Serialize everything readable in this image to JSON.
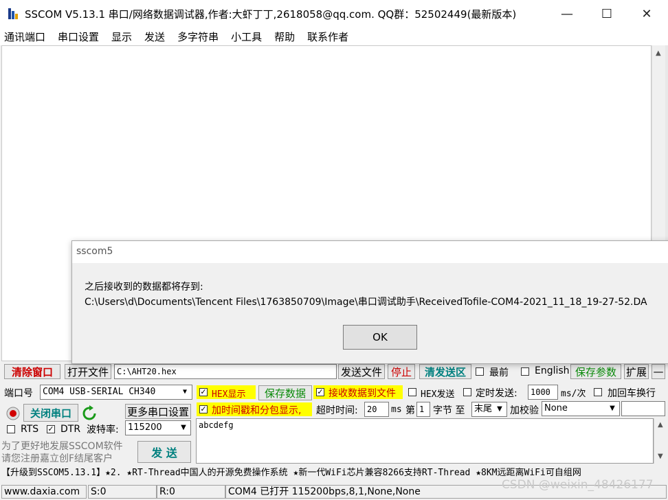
{
  "window": {
    "title": "SSCOM V5.13.1 串口/网络数据调试器,作者:大虾丁丁,2618058@qq.com. QQ群：52502449(最新版本)",
    "minimize": "—",
    "maximize": "☐",
    "close": "✕"
  },
  "menu": [
    "通讯端口",
    "串口设置",
    "显示",
    "发送",
    "多字符串",
    "小工具",
    "帮助",
    "联系作者"
  ],
  "dialog": {
    "title": "sscom5",
    "message_line1": "之后接收到的数据都将存到:",
    "message_line2": "C:\\Users\\d\\Documents\\Tencent Files\\1763850709\\Image\\串口调试助手\\ReceivedTofile-COM4-2021_11_18_19-27-52.DA",
    "ok": "OK"
  },
  "toolbar1": {
    "clear_window": "清除窗口",
    "open_file": "打开文件",
    "file_path": "C:\\AHT20.hex",
    "send_file": "发送文件",
    "stop": "停止",
    "clear_send": "清发送区",
    "topmost": "最前",
    "english": "English",
    "save_params": "保存参数",
    "expand": "扩展",
    "collapse": "—"
  },
  "port_panel": {
    "port_label": "端口号",
    "port_value": "COM4 USB-SERIAL CH340",
    "close_port": "关闭串口",
    "more_settings": "更多串口设置",
    "rts": "RTS",
    "dtr": "DTR",
    "baud_label": "波特率:",
    "baud_value": "115200",
    "promo_text_line1": "为了更好地发展SSCOM软件",
    "promo_text_line2": "请您注册嘉立创F结尾客户",
    "send": "发 送"
  },
  "options": {
    "hex_display": "HEX显示",
    "save_data": "保存数据",
    "recv_to_file": "接收数据到文件",
    "hex_send": "HEX发送",
    "timed_send": "定时发送:",
    "interval": "1000",
    "interval_unit": "ms/次",
    "add_crlf": "加回车换行",
    "timestamp": "加时间戳和分包显示,",
    "timeout_label": "超时时间:",
    "timeout_value": "20",
    "timeout_unit": "ms",
    "byte_prefix": "第",
    "byte_index": "1",
    "byte_suffix": "字节 至",
    "byte_end": "末尾",
    "checksum_label": "加校验",
    "checksum_value": "None",
    "hex_display_checked": true,
    "recv_to_file_checked": true,
    "timestamp_checked": true,
    "dtr_checked": true
  },
  "send_area": {
    "text": "abcdefg"
  },
  "promo_bar": "【升级到SSCOM5.13.1】★2. ★RT-Thread中国人的开源免费操作系统 ★新一代WiFi芯片兼容8266支持RT-Thread ★8KM远距离WiFi可自组网",
  "status": {
    "website": "www.daxia.com",
    "sent": "S:0",
    "received": "R:0",
    "port_status": "COM4 已打开  115200bps,8,1,None,None"
  },
  "watermark": "CSDN @weixin_48426177",
  "colors": {
    "accent_red": "#c00000",
    "accent_teal": "#00807f",
    "highlight_yellow": "#ffff00"
  }
}
